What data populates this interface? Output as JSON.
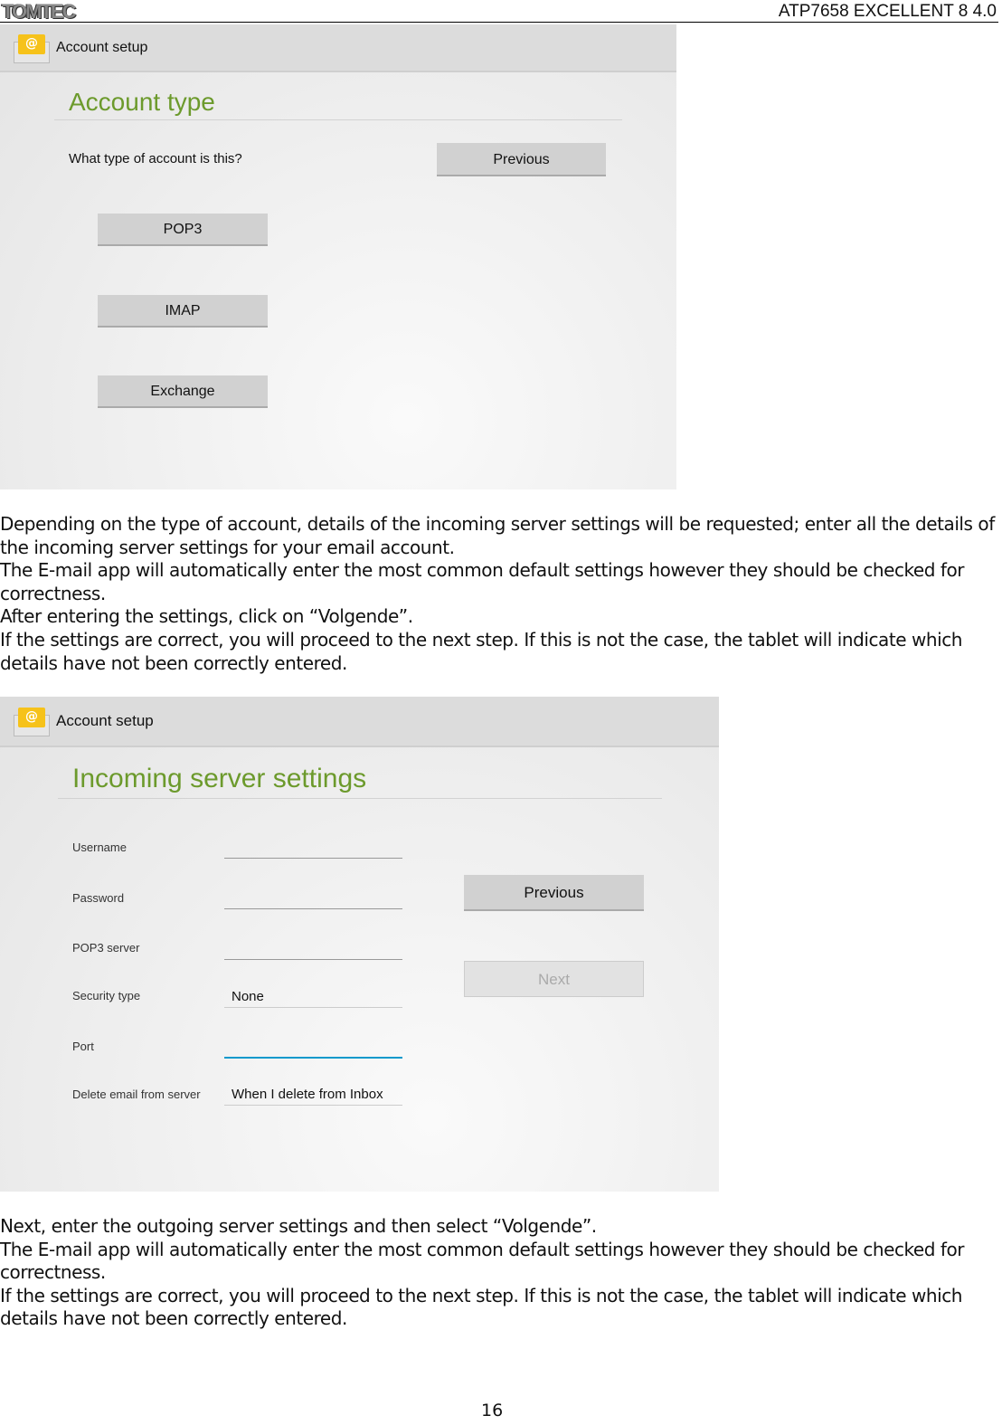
{
  "page_header": {
    "logo": "TOMTEC",
    "model": "ATP7658  EXCELLENT 8  4.0"
  },
  "shot1": {
    "bar_title": "Account setup",
    "heading": "Account type",
    "question": "What type of account is this?",
    "previous": "Previous",
    "options": [
      "POP3",
      "IMAP",
      "Exchange"
    ]
  },
  "para1": [
    "Depending on the type of account, details of the incoming server settings will be requested; enter all the details of the incoming server settings for your email account.",
    "The E-mail app will automatically enter the most common default settings however they should be checked for correctness.",
    "After entering the settings, click on “Volgende”.",
    "If the settings are correct, you will proceed to the next step. If this is not the case, the tablet will indicate which details have not been correctly entered."
  ],
  "shot2": {
    "bar_title": "Account setup",
    "heading": "Incoming server settings",
    "fields": [
      {
        "label": "Username",
        "value": ""
      },
      {
        "label": "Password",
        "value": ""
      },
      {
        "label": "POP3 server",
        "value": ""
      },
      {
        "label": "Security type",
        "value": "None"
      },
      {
        "label": "Port",
        "value": ""
      },
      {
        "label": "Delete email from server",
        "value": "When I delete from Inbox"
      }
    ],
    "previous": "Previous",
    "next": "Next"
  },
  "para2": [
    "Next, enter the outgoing server settings and then select “Volgende”.",
    "The E-mail app will automatically enter the most common default settings however they should be checked for correctness.",
    "If the settings are correct, you will proceed to the next step. If this is not the case, the tablet will indicate which details have not been correctly entered."
  ],
  "page_number": "16"
}
